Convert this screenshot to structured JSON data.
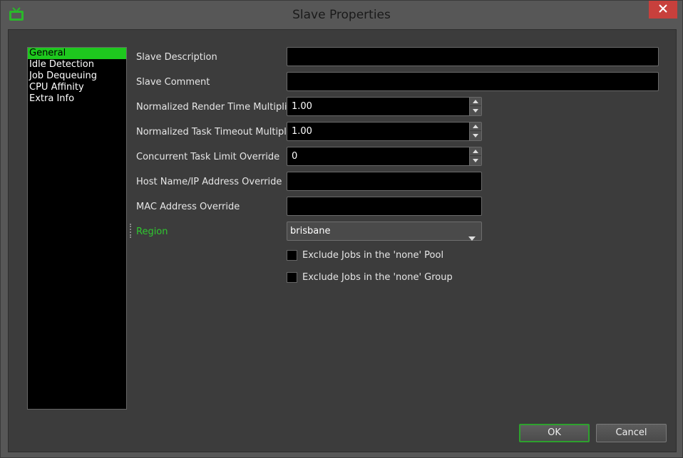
{
  "window": {
    "title": "Slave Properties",
    "app_icon": "tv-icon",
    "close_icon": "close-icon"
  },
  "nav": {
    "items": [
      {
        "label": "General",
        "active": true
      },
      {
        "label": "Idle Detection",
        "active": false
      },
      {
        "label": "Job Dequeuing",
        "active": false
      },
      {
        "label": "CPU Affinity",
        "active": false
      },
      {
        "label": "Extra Info",
        "active": false
      }
    ]
  },
  "form": {
    "slave_description": {
      "label": "Slave Description",
      "value": ""
    },
    "slave_comment": {
      "label": "Slave Comment",
      "value": ""
    },
    "render_time_multiplier": {
      "label": "Normalized Render Time Multiplier",
      "value": "1.00"
    },
    "task_timeout_multiplier": {
      "label": "Normalized Task Timeout Multiplier",
      "value": "1.00"
    },
    "concurrent_task_limit": {
      "label": "Concurrent Task Limit Override",
      "value": "0"
    },
    "host_name": {
      "label": "Host Name/IP Address Override",
      "value": ""
    },
    "mac_address": {
      "label": "MAC Address Override",
      "value": ""
    },
    "region": {
      "label": "Region",
      "selected": "brisbane"
    },
    "exclude_pool": {
      "label": "Exclude Jobs in the 'none' Pool",
      "checked": false
    },
    "exclude_group": {
      "label": "Exclude Jobs in the 'none' Group",
      "checked": false
    }
  },
  "buttons": {
    "ok": "OK",
    "cancel": "Cancel"
  },
  "colors": {
    "accent": "#1ec81e",
    "close": "#c8403c"
  }
}
